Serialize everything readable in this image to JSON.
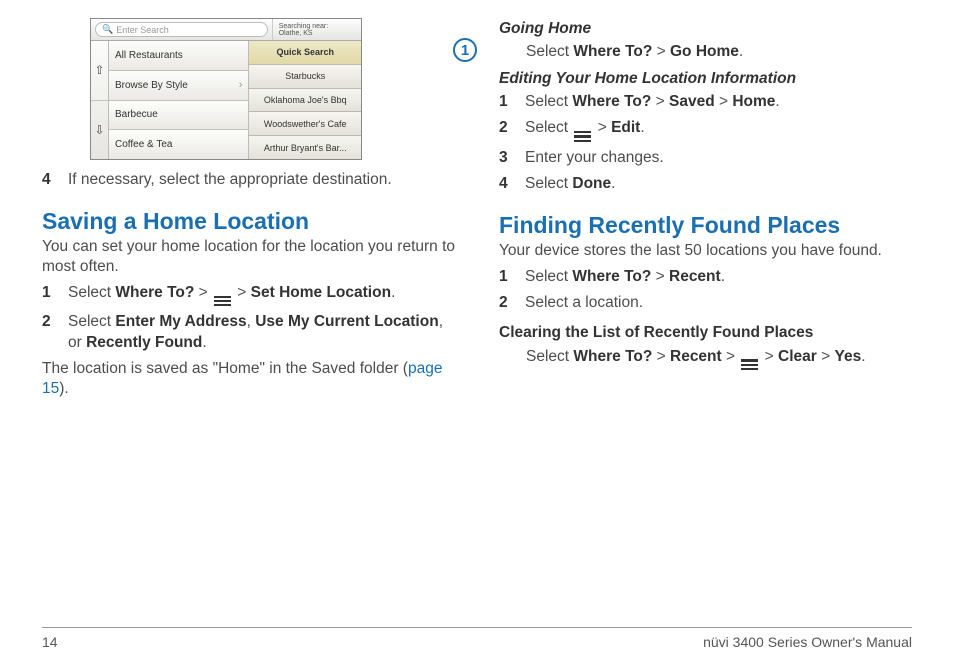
{
  "screenshot": {
    "search_placeholder": "Enter Search",
    "near_label": "Searching near:",
    "near_value": "Olathe, KS",
    "left_items": [
      "All Restaurants",
      "Browse By Style",
      "Barbecue",
      "Coffee & Tea"
    ],
    "right_items": [
      "Quick Search",
      "Starbucks",
      "Oklahoma Joe's Bbq",
      "Woodswether's Cafe",
      "Arthur Bryant's Bar..."
    ],
    "callout": "1"
  },
  "left": {
    "step4": "If necessary, select the appropriate destination.",
    "heading1": "Saving a Home Location",
    "intro1": "You can set your home location for the location you return to most often.",
    "s1_a": "Select ",
    "s1_b": "Where To?",
    "s1_c": " > ",
    "s1_d": " > ",
    "s1_e": "Set Home Location",
    "s1_f": ".",
    "s2_a": "Select ",
    "s2_b": "Enter My Address",
    "s2_c": ", ",
    "s2_d": "Use My Current Location",
    "s2_e": ", or ",
    "s2_f": "Recently Found",
    "s2_g": ".",
    "after_a": "The location is saved as \"Home\" in the Saved folder (",
    "after_link": "page 15",
    "after_b": ")."
  },
  "right": {
    "sub1": "Going Home",
    "gh_a": "Select ",
    "gh_b": "Where To?",
    "gh_c": " > ",
    "gh_d": "Go Home",
    "gh_e": ".",
    "sub2": "Editing Your Home Location Information",
    "e1_a": "Select ",
    "e1_b": "Where To?",
    "e1_c": " > ",
    "e1_d": "Saved",
    "e1_e": " > ",
    "e1_f": "Home",
    "e1_g": ".",
    "e2_a": "Select ",
    "e2_b": " > ",
    "e2_c": "Edit",
    "e2_d": ".",
    "e3": "Enter your changes.",
    "e4_a": "Select ",
    "e4_b": "Done",
    "e4_c": ".",
    "heading2": "Finding Recently Found Places",
    "intro2": "Your device stores the last 50 locations you have found.",
    "r1_a": "Select ",
    "r1_b": "Where To?",
    "r1_c": " > ",
    "r1_d": "Recent",
    "r1_e": ".",
    "r2": "Select a location.",
    "sub3": "Clearing the List of Recently Found Places",
    "c_a": "Select ",
    "c_b": "Where To?",
    "c_c": " > ",
    "c_d": "Recent",
    "c_e": " > ",
    "c_f": " > ",
    "c_g": "Clear",
    "c_h": " > ",
    "c_i": "Yes",
    "c_j": "."
  },
  "footer": {
    "page": "14",
    "title": "nüvi 3400 Series Owner's Manual"
  }
}
